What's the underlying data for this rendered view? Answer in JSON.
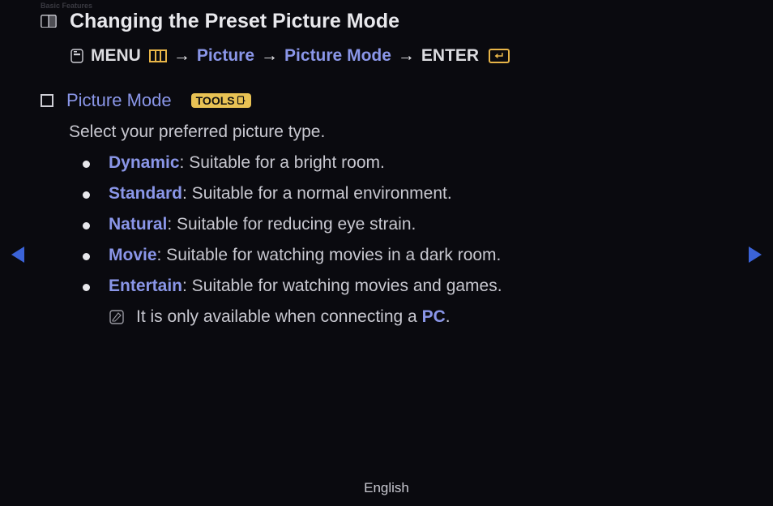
{
  "header_label": "Basic Features",
  "title": "Changing the Preset Picture Mode",
  "nav": {
    "menu": "MENU",
    "picture": "Picture",
    "picture_mode": "Picture Mode",
    "enter": "ENTER",
    "arrow": "→"
  },
  "section": {
    "title": "Picture Mode",
    "tools_label": "TOOLS",
    "description": "Select your preferred picture type."
  },
  "options": [
    {
      "name": "Dynamic",
      "desc": ": Suitable for a bright room."
    },
    {
      "name": "Standard",
      "desc": ": Suitable for a normal environment."
    },
    {
      "name": "Natural",
      "desc": ": Suitable for reducing eye strain."
    },
    {
      "name": "Movie",
      "desc": ": Suitable for watching movies in a dark room."
    },
    {
      "name": "Entertain",
      "desc": ": Suitable for watching movies and games."
    }
  ],
  "note": {
    "prefix": "It is only available when connecting a ",
    "link": "PC",
    "suffix": "."
  },
  "footer": "English"
}
